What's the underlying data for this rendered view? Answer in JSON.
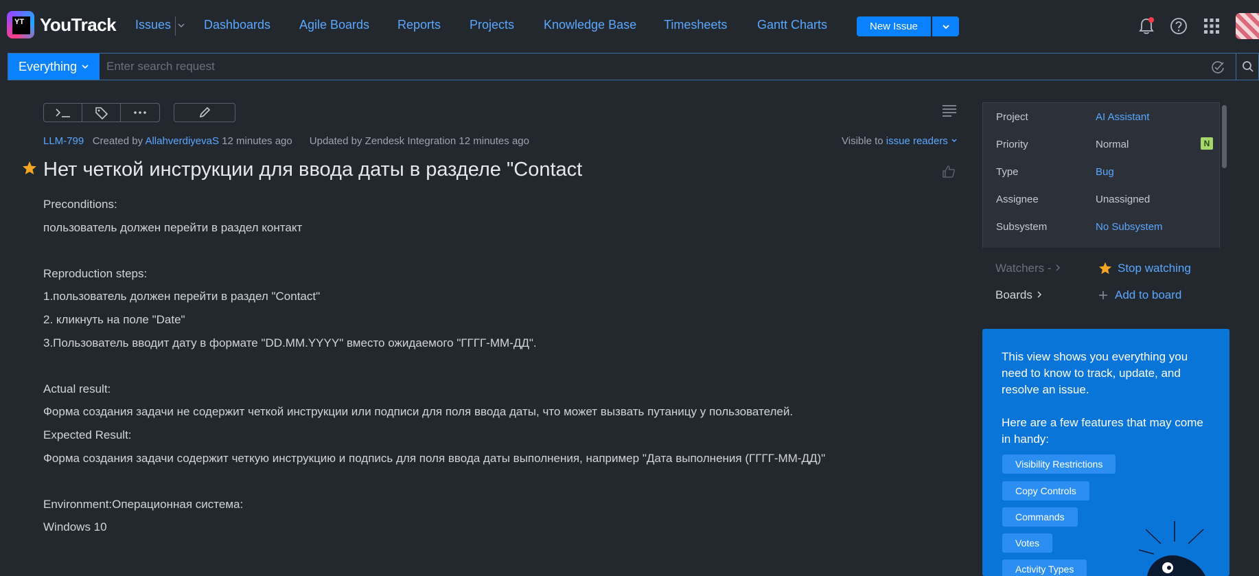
{
  "header": {
    "app_name": "YouTrack",
    "logo_letters": "YT",
    "nav": [
      "Issues",
      "Dashboards",
      "Agile Boards",
      "Reports",
      "Projects",
      "Knowledge Base",
      "Timesheets",
      "Gantt Charts"
    ],
    "new_issue_label": "New Issue",
    "icons": [
      "bell-icon",
      "help-icon",
      "apps-grid-icon"
    ],
    "notification_dot_color": "#ff3b4a"
  },
  "search": {
    "scope": "Everything",
    "placeholder": "Enter search request"
  },
  "issue": {
    "id": "LLM-799",
    "created_prefix": "Created by",
    "author": "AllahverdiyevaS",
    "created_time": "12 minutes ago",
    "updated_by": "Updated by Zendesk Integration 12 minutes ago",
    "visible_prefix": "Visible to",
    "visible_to": "issue readers",
    "title": "Нет четкой инструкции для ввода даты в разделе \"Contact",
    "description": [
      "Preconditions:",
      "пользователь должен перейти в раздел контакт",
      "",
      "Reproduction steps:",
      "1.пользователь должен перейти в раздел \"Contact\"",
      "2. кликнуть на поле \"Date\"",
      "3.Пользователь вводит дату в формате \"DD.MM.YYYY\" вместо ожидаемого \"ГГГГ-ММ-ДД\".",
      "",
      "Actual result:",
      "Форма создания задачи не содержит четкой инструкции или подписи для поля ввода даты, что может вызвать путаницу у пользователей.",
      "Expected Result:",
      "Форма создания задачи содержит четкую инструкцию и подпись для поля ввода даты выполнения, например \"Дата выполнения (ГГГГ-ММ-ДД)\"",
      "",
      "Environment:Операционная система:",
      "Windows 10"
    ]
  },
  "fields": [
    {
      "label": "Project",
      "value": "AI Assistant",
      "link": true
    },
    {
      "label": "Priority",
      "value": "Normal",
      "link": false,
      "badge": "N"
    },
    {
      "label": "Type",
      "value": "Bug",
      "link": true
    },
    {
      "label": "Assignee",
      "value": "Unassigned",
      "link": false
    },
    {
      "label": "Subsystem",
      "value": "No Subsystem",
      "link": true
    }
  ],
  "watch": {
    "watchers_label": "Watchers -",
    "stop_watching": "Stop watching",
    "boards_label": "Boards",
    "add_to_board": "Add to board"
  },
  "help": {
    "text1": "This view shows you everything you need to know to track, update, and resolve an issue.",
    "text2": "Here are a few features that may come in handy:",
    "chips": [
      "Visibility Restrictions",
      "Copy Controls",
      "Commands",
      "Votes",
      "Activity Types"
    ]
  },
  "colors": {
    "accent": "#0a82ff",
    "link": "#5aa8ff",
    "background": "#23272e",
    "star": "#f5a623",
    "help_panel": "#0a75d9"
  }
}
